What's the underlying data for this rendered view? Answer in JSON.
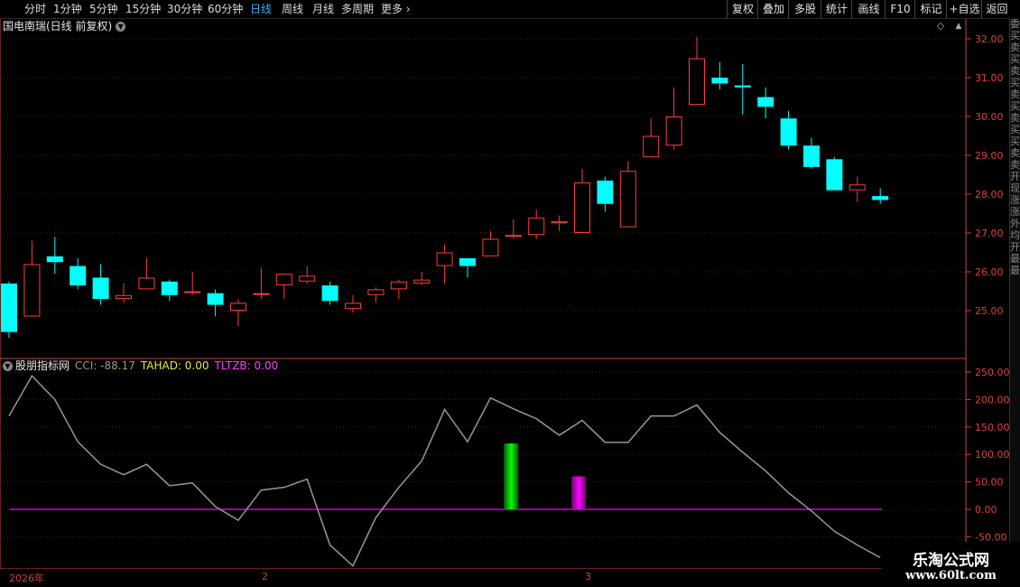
{
  "toolbar": {
    "left": [
      "分时",
      "1分钟",
      "5分钟",
      "15分钟",
      "30分钟",
      "60分钟",
      "日线",
      "周线",
      "月线",
      "多周期",
      "更多"
    ],
    "active": "日线",
    "right": [
      "复权",
      "叠加",
      "多股",
      "统计",
      "画线",
      "F10",
      "标记",
      "+自选",
      "返回"
    ]
  },
  "stock": {
    "title": "国电南瑞(日线 前复权)"
  },
  "indicator": {
    "name": "股朋指标网",
    "cci_label": "CCI: -88.17",
    "tahad_label": "TAHAD: 0.00",
    "tltzb_label": "TLTZB: 0.00"
  },
  "right_strip": {
    "text": "委买卖买卖买卖买卖买买卖卖开现涨涨外均开最最"
  },
  "dates": [
    "2026年",
    "2",
    "3"
  ],
  "watermark": {
    "title": "乐淘公式网",
    "url": "www.60lt.com"
  },
  "colors": {
    "up": "#ff3b3b",
    "down": "#00ffff",
    "cci": "#9a9a80",
    "tltzb_line": "#ff00ff",
    "tahad_bar": "#00ff00",
    "tltzb_bar": "#ff00ff",
    "axis": "#d23c3c",
    "grid": "#5a1818"
  },
  "chart_data": [
    {
      "type": "candlestick",
      "y_ticks": [
        32.0,
        31.0,
        30.0,
        29.0,
        28.0,
        27.0,
        26.0,
        25.0
      ],
      "ylim": [
        24.0,
        32.2
      ],
      "candles": [
        {
          "o": 25.7,
          "c": 24.45,
          "h": 25.75,
          "l": 24.3
        },
        {
          "o": 24.85,
          "c": 26.2,
          "h": 26.8,
          "l": 24.85
        },
        {
          "o": 26.4,
          "c": 26.25,
          "h": 26.9,
          "l": 25.95
        },
        {
          "o": 26.15,
          "c": 25.65,
          "h": 26.35,
          "l": 25.55
        },
        {
          "o": 25.85,
          "c": 25.3,
          "h": 26.2,
          "l": 25.15
        },
        {
          "o": 25.3,
          "c": 25.4,
          "h": 25.7,
          "l": 25.2
        },
        {
          "o": 25.55,
          "c": 25.85,
          "h": 26.35,
          "l": 25.55
        },
        {
          "o": 25.75,
          "c": 25.4,
          "h": 25.8,
          "l": 25.25
        },
        {
          "o": 25.45,
          "c": 25.5,
          "h": 26.0,
          "l": 25.4
        },
        {
          "o": 25.45,
          "c": 25.15,
          "h": 25.55,
          "l": 24.85
        },
        {
          "o": 25.0,
          "c": 25.2,
          "h": 25.3,
          "l": 24.6
        },
        {
          "o": 25.45,
          "c": 25.45,
          "h": 26.1,
          "l": 25.3
        },
        {
          "o": 25.65,
          "c": 25.95,
          "h": 25.95,
          "l": 25.3
        },
        {
          "o": 25.75,
          "c": 25.9,
          "h": 26.15,
          "l": 25.7
        },
        {
          "o": 25.65,
          "c": 25.25,
          "h": 25.75,
          "l": 25.15
        },
        {
          "o": 25.05,
          "c": 25.2,
          "h": 25.4,
          "l": 24.95
        },
        {
          "o": 25.4,
          "c": 25.55,
          "h": 25.6,
          "l": 25.2
        },
        {
          "o": 25.55,
          "c": 25.75,
          "h": 25.8,
          "l": 25.3
        },
        {
          "o": 25.7,
          "c": 25.8,
          "h": 26.0,
          "l": 25.65
        },
        {
          "o": 26.15,
          "c": 26.5,
          "h": 26.7,
          "l": 25.7
        },
        {
          "o": 26.35,
          "c": 26.15,
          "h": 26.35,
          "l": 25.85
        },
        {
          "o": 26.4,
          "c": 26.85,
          "h": 27.05,
          "l": 26.4
        },
        {
          "o": 26.9,
          "c": 26.95,
          "h": 27.35,
          "l": 26.85
        },
        {
          "o": 26.95,
          "c": 27.4,
          "h": 27.6,
          "l": 26.85
        },
        {
          "o": 27.25,
          "c": 27.3,
          "h": 27.45,
          "l": 27.05
        },
        {
          "o": 27.0,
          "c": 28.3,
          "h": 28.65,
          "l": 27.0
        },
        {
          "o": 28.35,
          "c": 27.75,
          "h": 28.45,
          "l": 27.55
        },
        {
          "o": 27.15,
          "c": 28.6,
          "h": 28.85,
          "l": 27.15
        },
        {
          "o": 28.95,
          "c": 29.5,
          "h": 29.95,
          "l": 28.95
        },
        {
          "o": 29.25,
          "c": 30.0,
          "h": 30.75,
          "l": 29.15
        },
        {
          "o": 30.3,
          "c": 31.5,
          "h": 32.05,
          "l": 30.3
        },
        {
          "o": 31.0,
          "c": 30.85,
          "h": 31.4,
          "l": 30.7
        },
        {
          "o": 30.8,
          "c": 30.75,
          "h": 31.35,
          "l": 30.05
        },
        {
          "o": 30.5,
          "c": 30.25,
          "h": 30.75,
          "l": 29.95
        },
        {
          "o": 29.95,
          "c": 29.25,
          "h": 30.15,
          "l": 29.15
        },
        {
          "o": 29.25,
          "c": 28.7,
          "h": 29.45,
          "l": 28.65
        },
        {
          "o": 28.9,
          "c": 28.1,
          "h": 28.95,
          "l": 28.1
        },
        {
          "o": 28.1,
          "c": 28.25,
          "h": 28.45,
          "l": 27.8
        },
        {
          "o": 27.95,
          "c": 27.85,
          "h": 28.15,
          "l": 27.75
        }
      ]
    },
    {
      "type": "line",
      "y_ticks": [
        250.0,
        200.0,
        150.0,
        100.0,
        50.0,
        0.0,
        -50.0
      ],
      "ylim": [
        -110,
        265
      ],
      "cci": [
        170,
        243,
        200,
        123,
        82,
        63,
        82,
        43,
        48,
        5,
        -20,
        35,
        40,
        55,
        -65,
        -103,
        -15,
        40,
        88,
        182,
        123,
        203,
        183,
        165,
        135,
        162,
        122,
        122,
        170,
        170,
        190,
        140,
        104,
        70,
        30,
        -3,
        -40,
        -65,
        -88
      ],
      "tltzb_line": 0,
      "bars": [
        {
          "series": "TAHAD",
          "index": 21.9,
          "value": 120
        },
        {
          "series": "TLTZB",
          "index": 24.85,
          "value": 60
        }
      ]
    }
  ]
}
